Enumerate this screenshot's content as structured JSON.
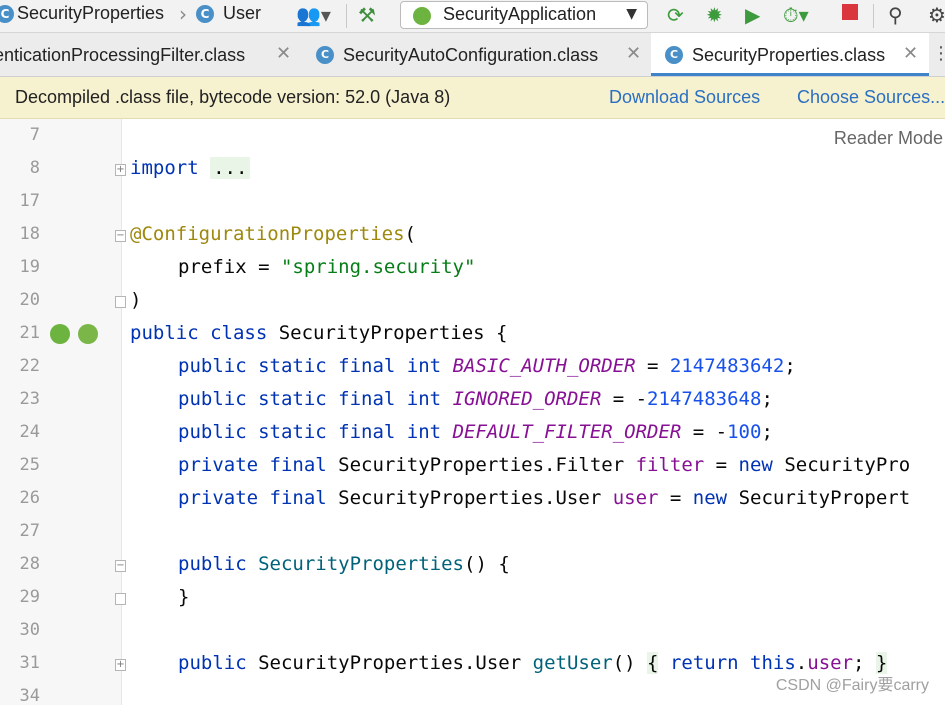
{
  "navbar": {
    "breadcrumb": [
      "SecurityProperties",
      "User"
    ],
    "run_config": "SecurityApplication",
    "icons": [
      "user-menu-icon",
      "build-hammer-icon",
      "rerun-icon",
      "debug-bug-icon",
      "coverage-icon",
      "profile-icon",
      "stop-icon",
      "search-icon",
      "settings-gear-icon"
    ]
  },
  "tabs": [
    {
      "label": "enticationProcessingFilter.class",
      "active": false
    },
    {
      "label": "SecurityAutoConfiguration.class",
      "active": false
    },
    {
      "label": "SecurityProperties.class",
      "active": true
    }
  ],
  "banner": {
    "message": "Decompiled .class file, bytecode version: 52.0 (Java 8)",
    "download_sources": "Download Sources",
    "choose_sources": "Choose Sources..."
  },
  "editor": {
    "reader_mode": "Reader Mode",
    "line_numbers": [
      "7",
      "8",
      "17",
      "18",
      "19",
      "20",
      "21",
      "22",
      "23",
      "24",
      "25",
      "26",
      "27",
      "28",
      "29",
      "30",
      "31",
      "34"
    ],
    "lines": {
      "l8_kw": "import",
      "l8_dots": "...",
      "l18_ann": "@ConfigurationProperties",
      "l18_paren": "(",
      "l19_key": "prefix = ",
      "l19_str": "\"spring.security\"",
      "l20": ")",
      "l21_kw": "public class",
      "l21_rest": " SecurityProperties {",
      "l22_kw": "public static final int",
      "l22_const": "BASIC_AUTH_ORDER",
      "l22_eq": " = ",
      "l22_num": "2147483642",
      "l22_end": ";",
      "l23_kw": "public static final int",
      "l23_const": "IGNORED_ORDER",
      "l23_eq": " = -",
      "l23_num": "2147483648",
      "l23_end": ";",
      "l24_kw": "public static final int",
      "l24_const": "DEFAULT_FILTER_ORDER",
      "l24_eq": " = -",
      "l24_num": "100",
      "l24_end": ";",
      "l25_kw": "private final",
      "l25_type": " SecurityProperties.Filter ",
      "l25_field": "filter",
      "l25_eq": " = ",
      "l25_new": "new",
      "l25_rest": " SecurityPro",
      "l26_kw": "private final",
      "l26_type": " SecurityProperties.User ",
      "l26_field": "user",
      "l26_eq": " = ",
      "l26_new": "new",
      "l26_rest": " SecurityPropert",
      "l28_kw": "public",
      "l28_meth": "SecurityProperties",
      "l28_rest": "() {",
      "l29": "}",
      "l31_kw": "public",
      "l31_type": " SecurityProperties.User ",
      "l31_meth": "getUser",
      "l31_paren": "() ",
      "l31_open": "{",
      "l31_ret": "return",
      "l31_this": "this",
      "l31_dot": ".",
      "l31_field": "user",
      "l31_semi": "; ",
      "l31_close": "}"
    }
  },
  "watermark": "CSDN @Fairy要carry"
}
